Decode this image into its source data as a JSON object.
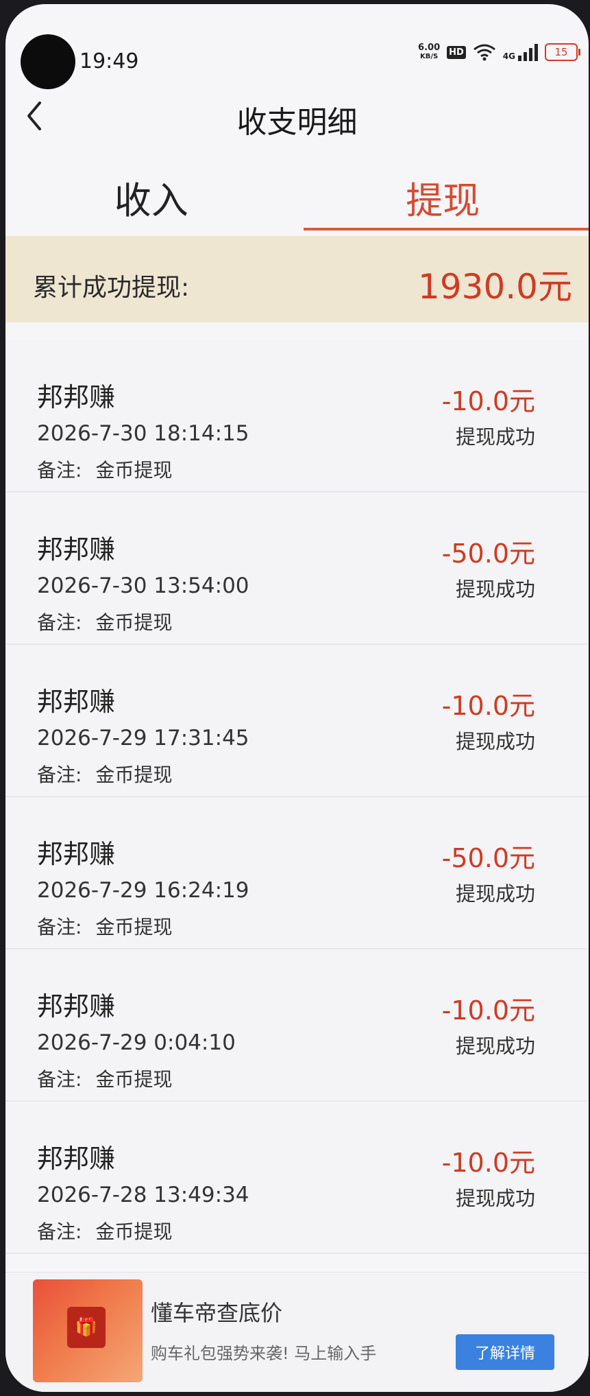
{
  "status_bar": {
    "time": "19:49",
    "net_speed_value": "6.00",
    "net_speed_unit": "KB/S",
    "hd_label": "HD",
    "network_label": "4G",
    "battery": "15"
  },
  "header": {
    "title": "收支明细"
  },
  "tabs": [
    {
      "label": "收入",
      "active": false
    },
    {
      "label": "提现",
      "active": true
    }
  ],
  "summary": {
    "label": "累计成功提现:",
    "value": "1930.0元"
  },
  "records": [
    {
      "name": "邦邦赚",
      "datetime": "2026-7-30 18:14:15",
      "note_label": "备注:",
      "note_value": "金币提现",
      "amount": "-10.0元",
      "status": "提现成功"
    },
    {
      "name": "邦邦赚",
      "datetime": "2026-7-30 13:54:00",
      "note_label": "备注:",
      "note_value": "金币提现",
      "amount": "-50.0元",
      "status": "提现成功"
    },
    {
      "name": "邦邦赚",
      "datetime": "2026-7-29 17:31:45",
      "note_label": "备注:",
      "note_value": "金币提现",
      "amount": "-10.0元",
      "status": "提现成功"
    },
    {
      "name": "邦邦赚",
      "datetime": "2026-7-29 16:24:19",
      "note_label": "备注:",
      "note_value": "金币提现",
      "amount": "-50.0元",
      "status": "提现成功"
    },
    {
      "name": "邦邦赚",
      "datetime": "2026-7-29 0:04:10",
      "note_label": "备注:",
      "note_value": "金币提现",
      "amount": "-10.0元",
      "status": "提现成功"
    },
    {
      "name": "邦邦赚",
      "datetime": "2026-7-28 13:49:34",
      "note_label": "备注:",
      "note_value": "金币提现",
      "amount": "-10.0元",
      "status": "提现成功"
    }
  ],
  "ad": {
    "title": "懂车帝查底价",
    "subtitle": "购车礼包强势来袭! 马上输入手",
    "button": "了解详情"
  },
  "colors": {
    "accent": "#d84a30",
    "summary_bg": "#efe6d2",
    "amount": "#cf3b22"
  }
}
